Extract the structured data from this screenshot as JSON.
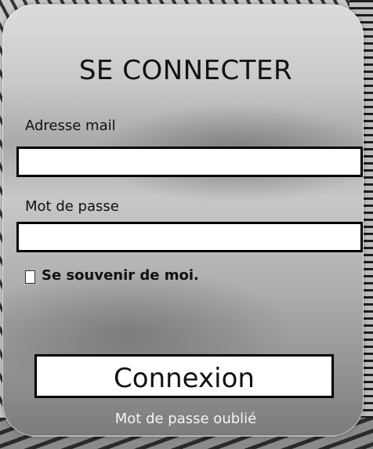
{
  "login": {
    "title": "SE CONNECTER",
    "email_label": "Adresse mail",
    "email_value": "",
    "password_label": "Mot de passe",
    "password_value": "",
    "remember_label": "Se souvenir de moi.",
    "remember_checked": false,
    "submit_label": "Connexion",
    "forgot_label": "Mot de passe oublié"
  }
}
